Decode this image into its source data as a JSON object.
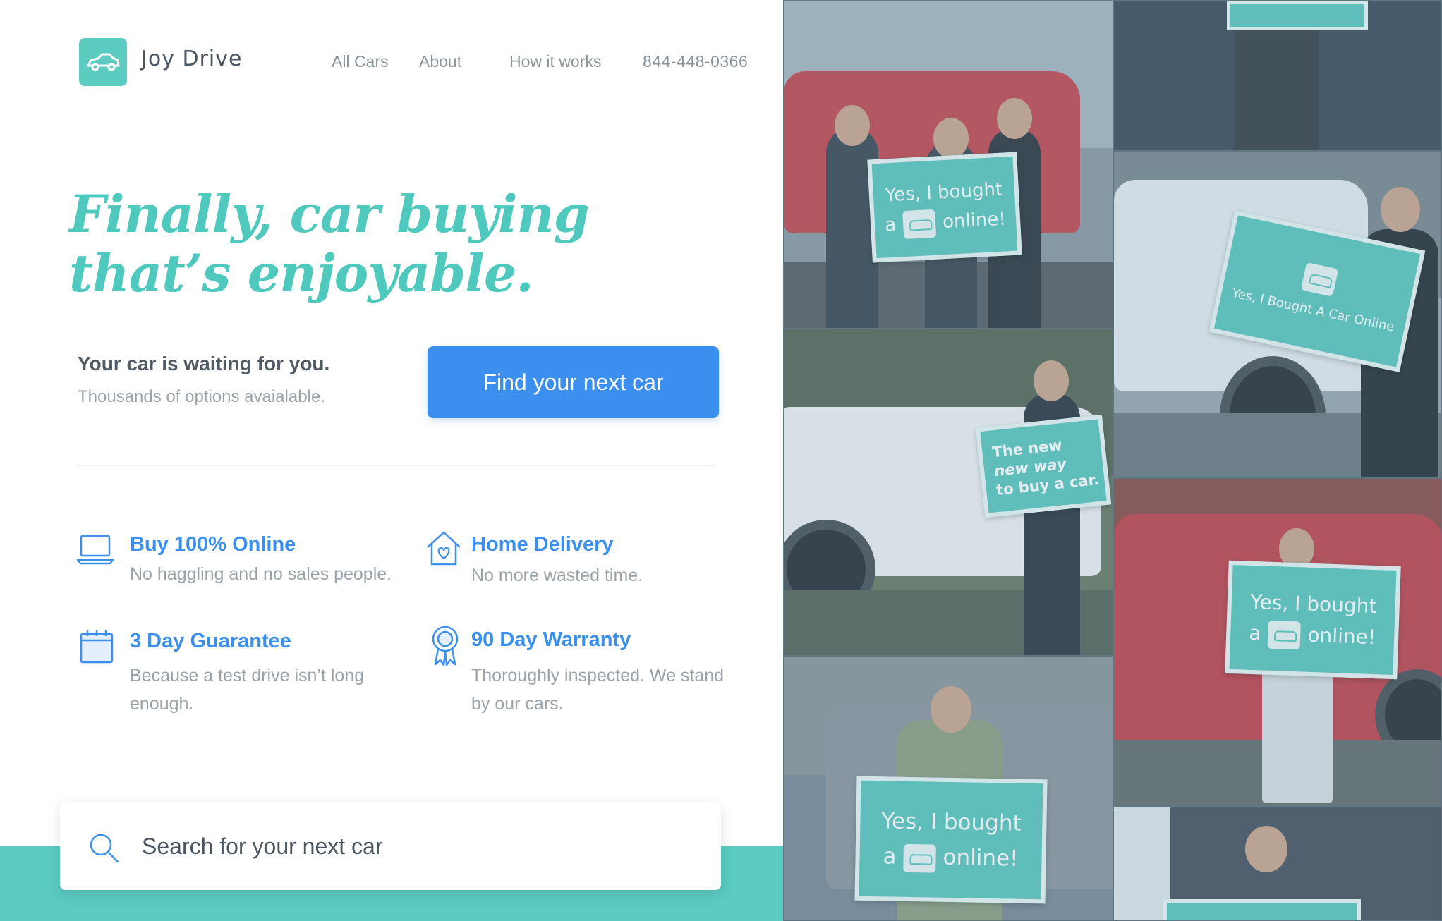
{
  "brand": {
    "name": "Joy Drive",
    "icon": "car-icon",
    "color": "#5ccbc0"
  },
  "nav": {
    "items": [
      {
        "label": "All Cars"
      },
      {
        "label": "About"
      },
      {
        "label": "How it works"
      }
    ],
    "phone": "844-448-0366"
  },
  "hero": {
    "headline_line1": "Finally, car buying",
    "headline_line2": "that’s enjoyable.",
    "subtitle": "Your car is waiting for you.",
    "subtext": "Thousands of options avaialable.",
    "cta_label": "Find your next car",
    "accent": "#4fc9bd",
    "cta_color": "#3b8fee"
  },
  "features": [
    {
      "icon": "laptop-icon",
      "title": "Buy 100% Online",
      "description": "No haggling and no sales people."
    },
    {
      "icon": "home-heart-icon",
      "title": "Home Delivery",
      "description": "No more wasted time."
    },
    {
      "icon": "calendar-icon",
      "title": "3 Day Guarantee",
      "description": "Because a test drive isn’t long enough."
    },
    {
      "icon": "ribbon-award-icon",
      "title": "90 Day Warranty",
      "description": "Thoroughly inspected. We stand by our cars."
    }
  ],
  "search": {
    "placeholder": "Search for your next car",
    "icon": "search-icon"
  },
  "photos": {
    "signs": {
      "bought_line1": "Yes, I bought",
      "bought_a": "a",
      "bought_online": "online!",
      "bought_caps": "Yes, I Bought A Car Online",
      "new_way_line1": "The new",
      "new_way_line2": "new way",
      "new_way_line3": "to buy a car."
    }
  }
}
